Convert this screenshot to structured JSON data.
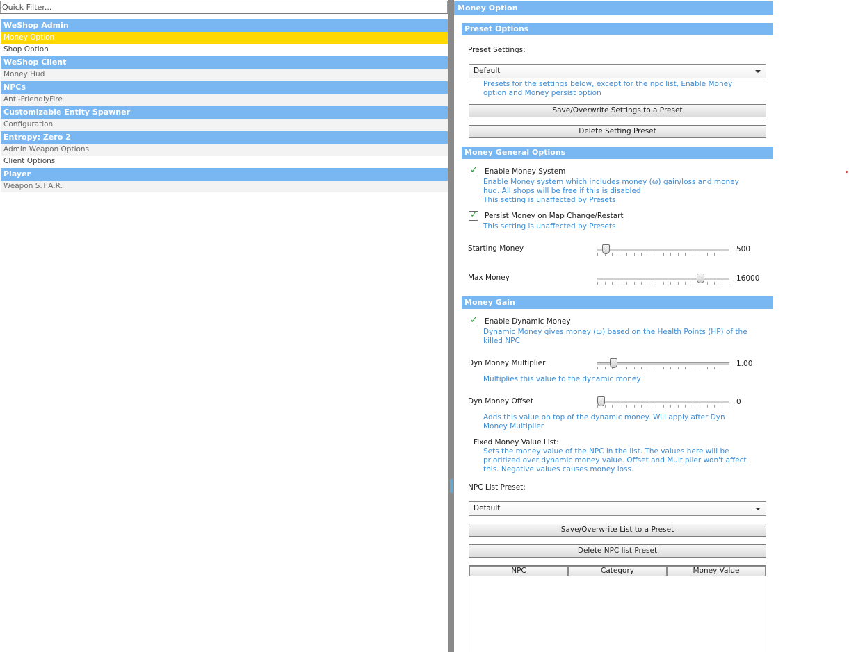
{
  "filter": {
    "placeholder": "Quick Filter..."
  },
  "categories": [
    {
      "header": "WeShop Admin",
      "items": [
        "Money Option",
        "Shop Option"
      ]
    },
    {
      "header": "WeShop Client",
      "items": [
        "Money Hud"
      ]
    },
    {
      "header": "NPCs",
      "items": [
        "Anti-FriendlyFire"
      ]
    },
    {
      "header": "Customizable Entity Spawner",
      "items": [
        "Configuration"
      ]
    },
    {
      "header": "Entropy: Zero 2",
      "items": [
        "Admin Weapon Options",
        "Client Options"
      ]
    },
    {
      "header": "Player",
      "items": [
        "Weapon S.T.A.R."
      ]
    }
  ],
  "selected_item": "Money Option",
  "panel": {
    "title": "Money Option",
    "preset": {
      "header": "Preset Options",
      "label": "Preset Settings:",
      "selected": "Default",
      "help": "Presets for the settings below, except for the npc list, Enable Money option and Money persist option",
      "save_button": "Save/Overwrite Settings to a Preset",
      "delete_button": "Delete Setting Preset"
    },
    "general": {
      "header": "Money General Options",
      "enable_money": {
        "label": "Enable Money System",
        "checked": true,
        "help1": "Enable Money system which includes money (ω) gain/loss and money hud. All shops will be free if this is disabled",
        "help2": "This setting is unaffected by Presets"
      },
      "persist_money": {
        "label": "Persist Money on Map Change/Restart",
        "checked": true,
        "help": "This setting is unaffected by Presets"
      },
      "starting_money": {
        "label": "Starting Money",
        "value": "500",
        "fraction": 0.04
      },
      "max_money": {
        "label": "Max Money",
        "value": "16000",
        "fraction": 0.8
      }
    },
    "gain": {
      "header": "Money Gain",
      "dynamic": {
        "label": "Enable Dynamic Money",
        "checked": true,
        "help": "Dynamic Money gives money (ω) based on the Health Points (HP) of the killed NPC"
      },
      "multiplier": {
        "label": "Dyn Money Multiplier",
        "value": "1.00",
        "fraction": 0.1,
        "help": "Multiplies this value to the dynamic money"
      },
      "offset": {
        "label": "Dyn Money Offset",
        "value": "0",
        "fraction": 0.0,
        "help": "Adds this value on top of the dynamic money. Will apply after Dyn Money Multiplier"
      },
      "fixed": {
        "label": "Fixed Money Value List:",
        "help": "Sets the money value of the NPC in the list. The values here will be prioritized over dynamic money value. Offset and Multiplier won't affect this. Negative values causes money loss."
      },
      "npc_preset": {
        "label": "NPC List Preset:",
        "selected": "Default",
        "save_button": "Save/Overwrite List to a Preset",
        "delete_button": "Delete NPC list Preset"
      },
      "table_columns": [
        "NPC",
        "Category",
        "Money Value"
      ]
    }
  },
  "colors": {
    "header": "#78b7f2",
    "selected": "#ffd800",
    "help_text": "#3d8ed6",
    "check": "#2c9a3a"
  },
  "icons": {
    "checkbox": "check-mark-icon",
    "combo": "chevron-down-icon",
    "slider": "slider-knob-icon"
  }
}
